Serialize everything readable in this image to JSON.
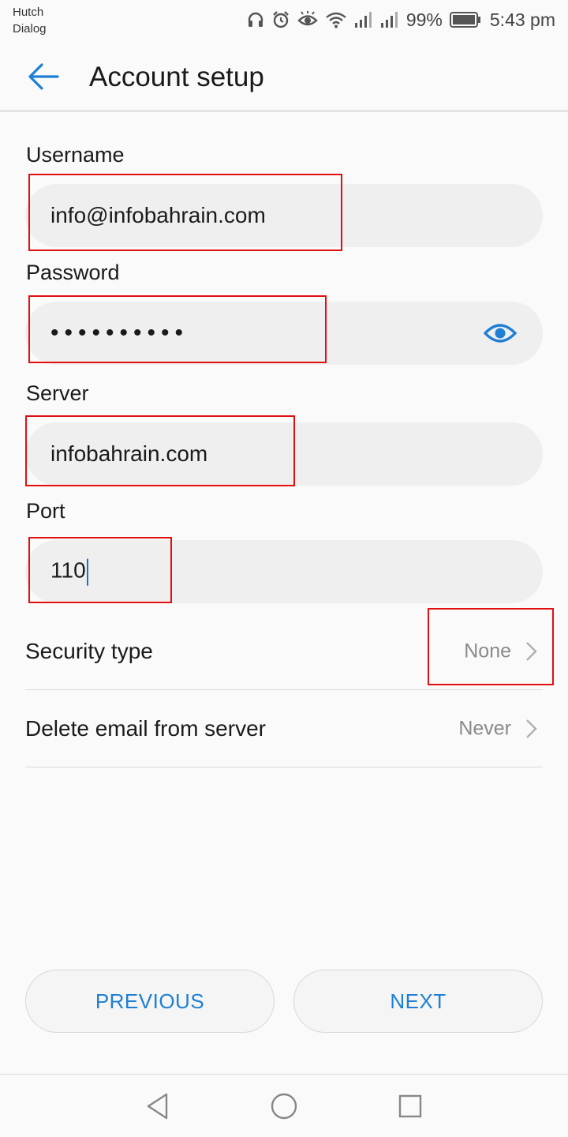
{
  "status_bar": {
    "carrier_line1": "Hutch",
    "carrier_line2": "Dialog",
    "battery_percent": "99%",
    "time": "5:43 pm",
    "icons": [
      "headset-icon",
      "alarm-icon",
      "eye-comfort-icon",
      "wifi-icon",
      "signal-icon",
      "signal-icon",
      "battery-icon"
    ]
  },
  "app_bar": {
    "title": "Account setup",
    "back_icon": "arrow-left-icon"
  },
  "form": {
    "username": {
      "label": "Username",
      "value": "info@infobahrain.com"
    },
    "password": {
      "label": "Password",
      "masked_value": "••••••••••",
      "toggle_icon": "eye-icon"
    },
    "server": {
      "label": "Server",
      "value": "infobahrain.com"
    },
    "port": {
      "label": "Port",
      "value": "110"
    }
  },
  "settings": {
    "security_type": {
      "label": "Security type",
      "value": "None"
    },
    "delete_email": {
      "label": "Delete email from server",
      "value": "Never"
    }
  },
  "buttons": {
    "previous": "PREVIOUS",
    "next": "NEXT"
  },
  "nav_bar": {
    "icons": [
      "back-triangle-icon",
      "home-circle-icon",
      "recents-square-icon"
    ]
  },
  "colors": {
    "accent": "#1e7fd4",
    "highlight_box": "#e01010",
    "field_background": "#efefef",
    "page_background": "#fafafa"
  }
}
